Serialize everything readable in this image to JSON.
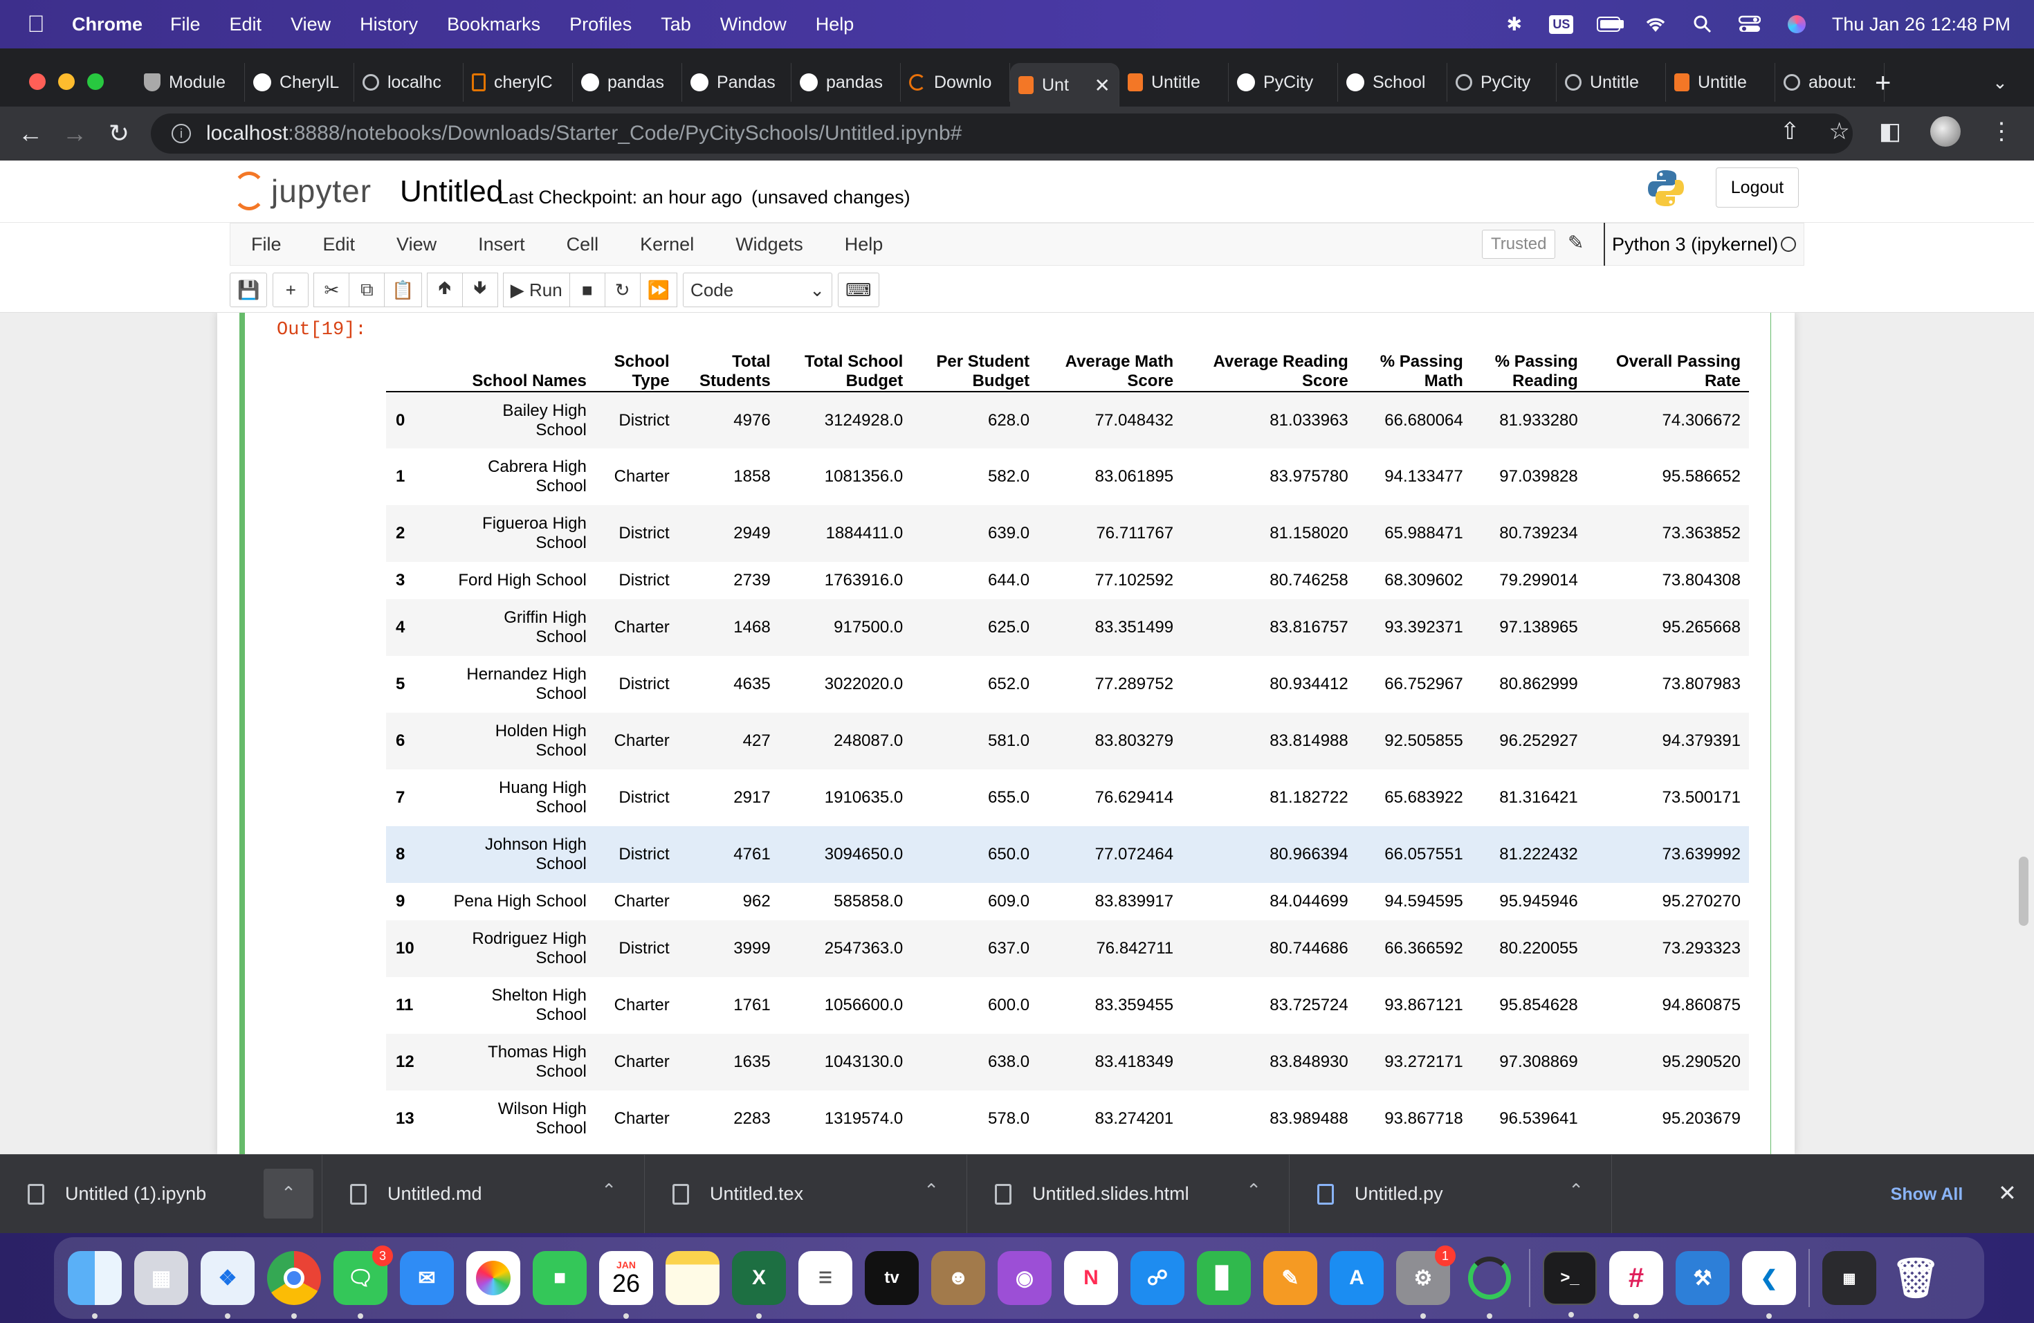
{
  "menubar": {
    "app": "Chrome",
    "items": [
      "File",
      "Edit",
      "View",
      "History",
      "Bookmarks",
      "Profiles",
      "Tab",
      "Window",
      "Help"
    ],
    "input_source": "US",
    "datetime": "Thu Jan 26  12:48 PM"
  },
  "browser": {
    "tabs": [
      {
        "label": "Module",
        "icon": "university-shield-icon"
      },
      {
        "label": "CherylL",
        "icon": "github-icon"
      },
      {
        "label": "localhc",
        "icon": "globe-icon"
      },
      {
        "label": "cherylC",
        "icon": "document-icon"
      },
      {
        "label": "pandas",
        "icon": "github-icon"
      },
      {
        "label": "Pandas",
        "icon": "github-icon"
      },
      {
        "label": "pandas",
        "icon": "github-icon"
      },
      {
        "label": "Downlo",
        "icon": "loading-icon"
      },
      {
        "label": "Unt",
        "icon": "jupyter-icon",
        "active": true
      },
      {
        "label": "Untitle",
        "icon": "jupyter-icon"
      },
      {
        "label": "PyCity",
        "icon": "github-icon"
      },
      {
        "label": "School",
        "icon": "github-icon"
      },
      {
        "label": "PyCity",
        "icon": "globe-icon"
      },
      {
        "label": "Untitle",
        "icon": "globe-icon"
      },
      {
        "label": "Untitle",
        "icon": "jupyter-icon"
      },
      {
        "label": "about:",
        "icon": "globe-icon"
      }
    ],
    "url_host": "localhost",
    "url_path": ":8888/notebooks/Downloads/Starter_Code/PyCitySchools/Untitled.ipynb#"
  },
  "jupyter": {
    "logo_text": "jupyter",
    "notebook_title": "Untitled",
    "checkpoint": "Last Checkpoint: an hour ago",
    "unsaved": "(unsaved changes)",
    "logout_label": "Logout",
    "menu": [
      "File",
      "Edit",
      "View",
      "Insert",
      "Cell",
      "Kernel",
      "Widgets",
      "Help"
    ],
    "trusted_label": "Trusted",
    "kernel_name": "Python 3 (ipykernel)",
    "run_label": "Run",
    "cell_type": "Code",
    "out_prompt": "Out[19]:"
  },
  "table": {
    "columns": [
      [
        "School Names"
      ],
      [
        "School",
        "Type"
      ],
      [
        "Total",
        "Students"
      ],
      [
        "Total School",
        "Budget"
      ],
      [
        "Per Student",
        "Budget"
      ],
      [
        "Average Math",
        "Score"
      ],
      [
        "Average Reading",
        "Score"
      ],
      [
        "% Passing",
        "Math"
      ],
      [
        "% Passing",
        "Reading"
      ],
      [
        "Overall Passing",
        "Rate"
      ]
    ],
    "rows": [
      {
        "idx": "0",
        "name": [
          "Bailey High",
          "School"
        ],
        "type": "District",
        "students": "4976",
        "budget": "3124928.0",
        "per_student": "628.0",
        "math": "77.048432",
        "reading": "81.033963",
        "pass_math": "66.680064",
        "pass_reading": "81.933280",
        "overall": "74.306672"
      },
      {
        "idx": "1",
        "name": [
          "Cabrera High",
          "School"
        ],
        "type": "Charter",
        "students": "1858",
        "budget": "1081356.0",
        "per_student": "582.0",
        "math": "83.061895",
        "reading": "83.975780",
        "pass_math": "94.133477",
        "pass_reading": "97.039828",
        "overall": "95.586652"
      },
      {
        "idx": "2",
        "name": [
          "Figueroa High",
          "School"
        ],
        "type": "District",
        "students": "2949",
        "budget": "1884411.0",
        "per_student": "639.0",
        "math": "76.711767",
        "reading": "81.158020",
        "pass_math": "65.988471",
        "pass_reading": "80.739234",
        "overall": "73.363852"
      },
      {
        "idx": "3",
        "name": [
          "Ford High School"
        ],
        "type": "District",
        "students": "2739",
        "budget": "1763916.0",
        "per_student": "644.0",
        "math": "77.102592",
        "reading": "80.746258",
        "pass_math": "68.309602",
        "pass_reading": "79.299014",
        "overall": "73.804308"
      },
      {
        "idx": "4",
        "name": [
          "Griffin High",
          "School"
        ],
        "type": "Charter",
        "students": "1468",
        "budget": "917500.0",
        "per_student": "625.0",
        "math": "83.351499",
        "reading": "83.816757",
        "pass_math": "93.392371",
        "pass_reading": "97.138965",
        "overall": "95.265668"
      },
      {
        "idx": "5",
        "name": [
          "Hernandez High",
          "School"
        ],
        "type": "District",
        "students": "4635",
        "budget": "3022020.0",
        "per_student": "652.0",
        "math": "77.289752",
        "reading": "80.934412",
        "pass_math": "66.752967",
        "pass_reading": "80.862999",
        "overall": "73.807983"
      },
      {
        "idx": "6",
        "name": [
          "Holden High",
          "School"
        ],
        "type": "Charter",
        "students": "427",
        "budget": "248087.0",
        "per_student": "581.0",
        "math": "83.803279",
        "reading": "83.814988",
        "pass_math": "92.505855",
        "pass_reading": "96.252927",
        "overall": "94.379391"
      },
      {
        "idx": "7",
        "name": [
          "Huang High",
          "School"
        ],
        "type": "District",
        "students": "2917",
        "budget": "1910635.0",
        "per_student": "655.0",
        "math": "76.629414",
        "reading": "81.182722",
        "pass_math": "65.683922",
        "pass_reading": "81.316421",
        "overall": "73.500171"
      },
      {
        "idx": "8",
        "name": [
          "Johnson High",
          "School"
        ],
        "type": "District",
        "students": "4761",
        "budget": "3094650.0",
        "per_student": "650.0",
        "math": "77.072464",
        "reading": "80.966394",
        "pass_math": "66.057551",
        "pass_reading": "81.222432",
        "overall": "73.639992",
        "hover": true
      },
      {
        "idx": "9",
        "name": [
          "Pena High School"
        ],
        "type": "Charter",
        "students": "962",
        "budget": "585858.0",
        "per_student": "609.0",
        "math": "83.839917",
        "reading": "84.044699",
        "pass_math": "94.594595",
        "pass_reading": "95.945946",
        "overall": "95.270270"
      },
      {
        "idx": "10",
        "name": [
          "Rodriguez High",
          "School"
        ],
        "type": "District",
        "students": "3999",
        "budget": "2547363.0",
        "per_student": "637.0",
        "math": "76.842711",
        "reading": "80.744686",
        "pass_math": "66.366592",
        "pass_reading": "80.220055",
        "overall": "73.293323"
      },
      {
        "idx": "11",
        "name": [
          "Shelton High",
          "School"
        ],
        "type": "Charter",
        "students": "1761",
        "budget": "1056600.0",
        "per_student": "600.0",
        "math": "83.359455",
        "reading": "83.725724",
        "pass_math": "93.867121",
        "pass_reading": "95.854628",
        "overall": "94.860875"
      },
      {
        "idx": "12",
        "name": [
          "Thomas High",
          "School"
        ],
        "type": "Charter",
        "students": "1635",
        "budget": "1043130.0",
        "per_student": "638.0",
        "math": "83.418349",
        "reading": "83.848930",
        "pass_math": "93.272171",
        "pass_reading": "97.308869",
        "overall": "95.290520"
      },
      {
        "idx": "13",
        "name": [
          "Wilson High",
          "School"
        ],
        "type": "Charter",
        "students": "2283",
        "budget": "1319574.0",
        "per_student": "578.0",
        "math": "83.274201",
        "reading": "83.989488",
        "pass_math": "93.867718",
        "pass_reading": "96.539641",
        "overall": "95.203679"
      }
    ]
  },
  "downloads": {
    "items": [
      {
        "name": "Untitled (1).ipynb",
        "icon": "file-icon"
      },
      {
        "name": "Untitled.md",
        "icon": "file-icon"
      },
      {
        "name": "Untitled.tex",
        "icon": "file-icon"
      },
      {
        "name": "Untitled.slides.html",
        "icon": "file-icon"
      },
      {
        "name": "Untitled.py",
        "icon": "python-file-icon"
      }
    ],
    "show_all": "Show All"
  },
  "dock": {
    "calendar_month": "JAN",
    "calendar_day": "26",
    "messages_badge": "3",
    "settings_badge": "1",
    "appletv_label": "tv"
  }
}
